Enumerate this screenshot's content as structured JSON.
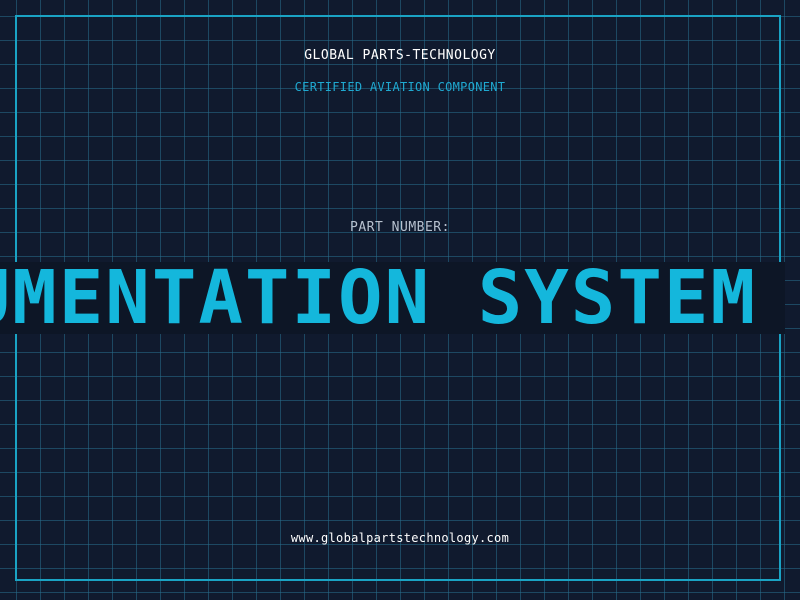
{
  "header": {
    "company": "GLOBAL PARTS-TECHNOLOGY",
    "subtitle": "CERTIFIED AVIATION COMPONENT"
  },
  "part": {
    "label": "PART NUMBER:",
    "value": "INSTRUMENTATION SYSTEM"
  },
  "footer": {
    "url": "www.globalpartstechnology.com"
  },
  "colors": {
    "background": "#101a2e",
    "grid": "#286e8c",
    "frame": "#1aa3c4",
    "accent": "#14b7dc",
    "banner_background": "#0d1626"
  }
}
